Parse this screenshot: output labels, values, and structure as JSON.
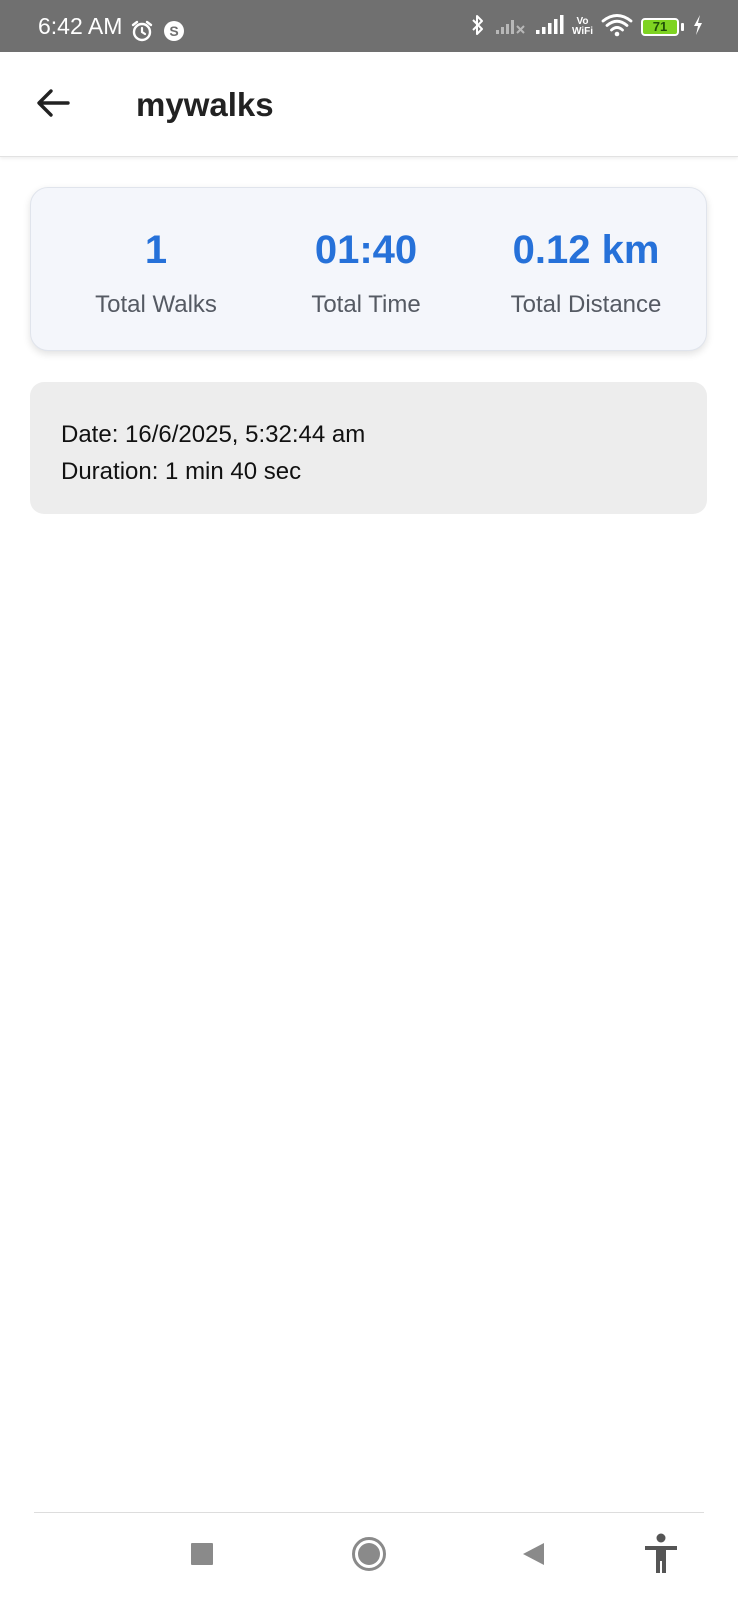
{
  "status_bar": {
    "time": "6:42 AM",
    "battery_level": "71",
    "vowifi_top": "Vo",
    "vowifi_bottom": "WiFi",
    "icons": [
      "alarm-icon",
      "s-app-icon",
      "bluetooth-icon",
      "signal-no-service-icon",
      "signal-icon",
      "vowifi-icon",
      "wifi-icon",
      "battery-icon",
      "charging-icon"
    ]
  },
  "app_bar": {
    "title": "mywalks",
    "back_icon": "arrow-left-icon"
  },
  "summary": {
    "total_walks_value": "1",
    "total_walks_label": "Total Walks",
    "total_time_value": "01:40",
    "total_time_label": "Total Time",
    "total_distance_value": "0.12 km",
    "total_distance_label": "Total Distance"
  },
  "walks": [
    {
      "date": "Date: 16/6/2025, 5:32:44 am",
      "duration": "Duration: 1 min 40 sec"
    }
  ],
  "nav_bar": {
    "icons": [
      "recents-square-icon",
      "home-circle-icon",
      "back-triangle-icon",
      "accessibility-icon"
    ]
  },
  "colors": {
    "accent": "#2671d9",
    "status_bar_bg": "#707070",
    "card_bg": "#f4f6fb",
    "entry_bg": "#ededed",
    "battery_fill": "#7ed321"
  }
}
